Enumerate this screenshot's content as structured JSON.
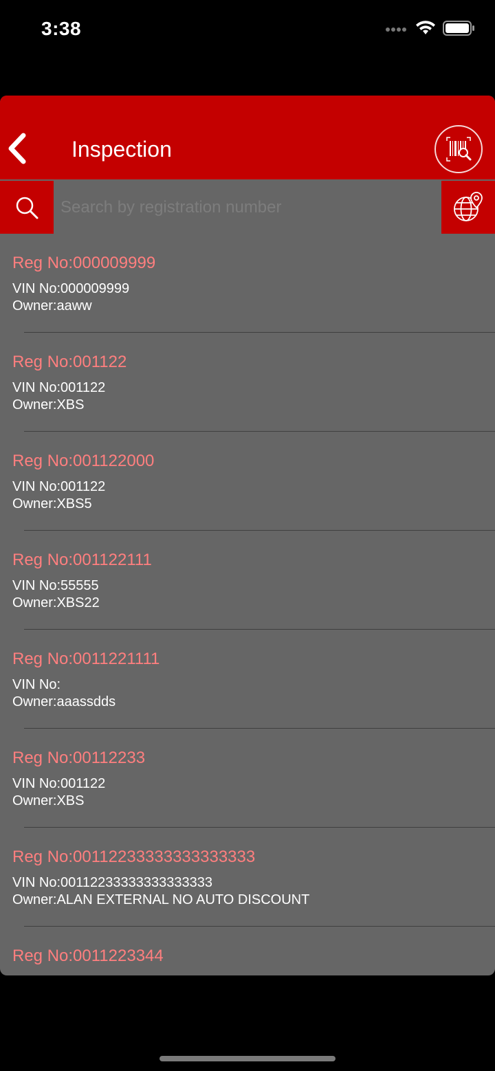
{
  "status_bar": {
    "time": "3:38"
  },
  "nav": {
    "title": "Inspection",
    "back_icon": "chevron-left-icon",
    "scan_icon": "barcode-search-icon"
  },
  "search": {
    "placeholder": "Search by registration number",
    "value": "",
    "search_icon": "search-icon",
    "geo_icon": "globe-location-icon"
  },
  "colors": {
    "brand_red": "#c40000",
    "reg_text": "#ff7f7f",
    "sheet_bg": "#666666"
  },
  "items": [
    {
      "reg": "Reg No:000009999",
      "vin": "VIN No:000009999",
      "owner": "Owner:aaww"
    },
    {
      "reg": "Reg No:001122",
      "vin": "VIN No:001122",
      "owner": "Owner:XBS"
    },
    {
      "reg": "Reg No:001122000",
      "vin": "VIN No:001122",
      "owner": "Owner:XBS5"
    },
    {
      "reg": "Reg No:001122111",
      "vin": "VIN No:55555",
      "owner": "Owner:XBS22"
    },
    {
      "reg": "Reg No:0011221111",
      "vin": "VIN No:",
      "owner": "Owner:aaassdds"
    },
    {
      "reg": "Reg No:00112233",
      "vin": "VIN No:001122",
      "owner": "Owner:XBS"
    },
    {
      "reg": "Reg No:00112233333333333333",
      "vin": "VIN No:00112233333333333333",
      "owner": "Owner:ALAN EXTERNAL NO AUTO DISCOUNT"
    },
    {
      "reg": "Reg No:0011223344",
      "vin": "",
      "owner": ""
    }
  ]
}
